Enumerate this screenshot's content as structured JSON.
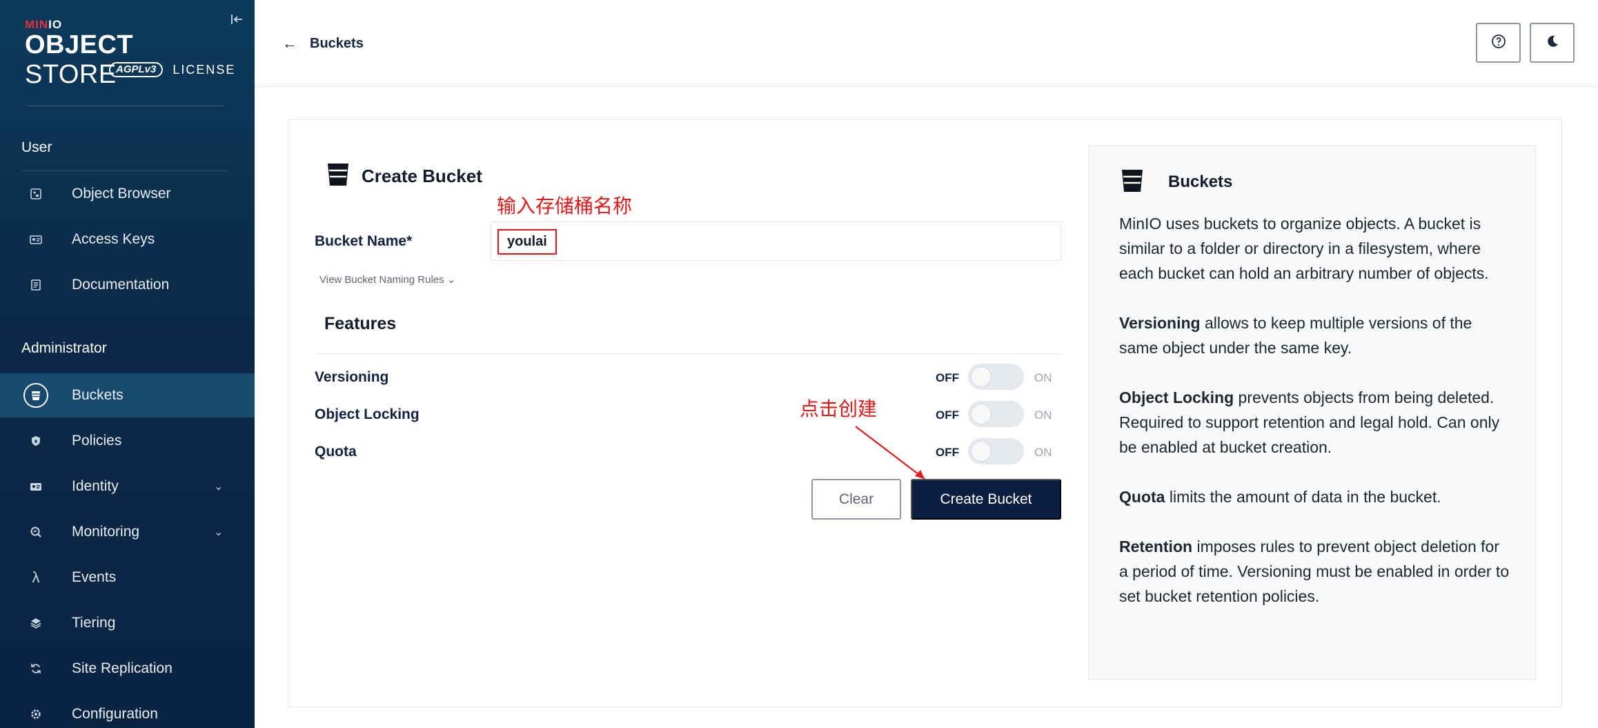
{
  "sidebar": {
    "brand_small_prefix": "MIN",
    "brand_small_suffix": "IO",
    "brand_big_bold": "OBJECT",
    "brand_big_rest": " STORE",
    "brand_agpl": "AGPLv3",
    "brand_license": "LICENSE",
    "user_section": "User",
    "admin_section": "Administrator",
    "user_items": [
      {
        "label": "Object Browser",
        "icon": "object-browser-icon"
      },
      {
        "label": "Access Keys",
        "icon": "access-keys-icon"
      },
      {
        "label": "Documentation",
        "icon": "documentation-icon"
      }
    ],
    "admin_items": [
      {
        "label": "Buckets",
        "icon": "bucket-icon",
        "active": true
      },
      {
        "label": "Policies",
        "icon": "shield-icon"
      },
      {
        "label": "Identity",
        "icon": "identity-icon",
        "expandable": true
      },
      {
        "label": "Monitoring",
        "icon": "monitoring-icon",
        "expandable": true
      },
      {
        "label": "Events",
        "icon": "lambda-icon"
      },
      {
        "label": "Tiering",
        "icon": "layers-icon"
      },
      {
        "label": "Site Replication",
        "icon": "replication-icon"
      },
      {
        "label": "Configuration",
        "icon": "gear-icon"
      }
    ]
  },
  "header": {
    "back_label": "Buckets"
  },
  "form": {
    "title": "Create Bucket",
    "annotation_name": "输入存储桶名称",
    "bucket_name_label": "Bucket Name*",
    "bucket_name_value": "youlai",
    "naming_rules_label": "View Bucket Naming Rules",
    "features_title": "Features",
    "features": [
      {
        "label": "Versioning",
        "off": "OFF",
        "on": "ON",
        "enabled": false
      },
      {
        "label": "Object Locking",
        "off": "OFF",
        "on": "ON",
        "enabled": false
      },
      {
        "label": "Quota",
        "off": "OFF",
        "on": "ON",
        "enabled": false
      }
    ],
    "annotation_create": "点击创建",
    "clear_label": "Clear",
    "create_label": "Create Bucket"
  },
  "info": {
    "title": "Buckets",
    "intro": "MinIO uses buckets to organize objects. A bucket is similar to a folder or directory in a filesystem, where each bucket can hold an arbitrary number of objects.",
    "paragraphs": [
      {
        "term": "Versioning",
        "text": " allows to keep multiple versions of the same object under the same key."
      },
      {
        "term": "Object Locking",
        "text": " prevents objects from being deleted. Required to support retention and legal hold. Can only be enabled at bucket creation."
      },
      {
        "term": "Quota",
        "text": " limits the amount of data in the bucket."
      },
      {
        "term": "Retention",
        "text": " imposes rules to prevent object deletion for a period of time. Versioning must be enabled in order to set bucket retention policies."
      }
    ]
  },
  "colors": {
    "sidebar_bg": "#0c2b49",
    "primary_button": "#0c1f40",
    "annotation_red": "#e31919"
  }
}
